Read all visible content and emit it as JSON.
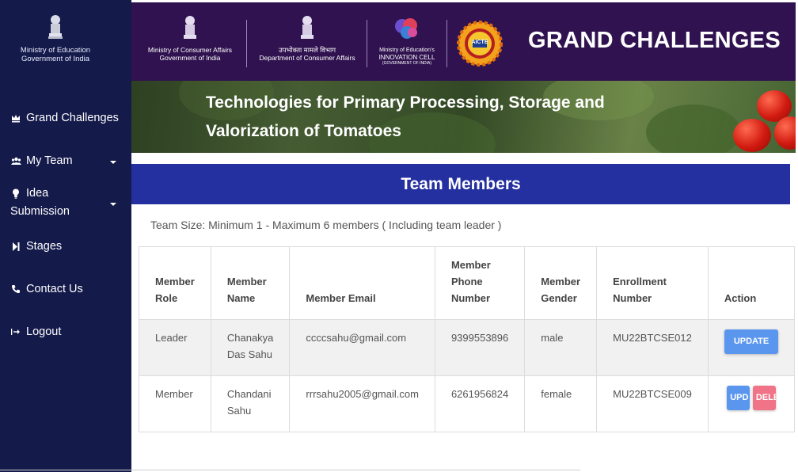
{
  "sidebar": {
    "logo_lines": [
      "Ministry of Education",
      "Government of India"
    ],
    "items": [
      {
        "label": "Grand Challenges",
        "icon": "crown-icon"
      },
      {
        "label": "My Team",
        "icon": "users-icon"
      },
      {
        "label": "Idea",
        "label2": "Submission",
        "icon": "bulb-icon"
      },
      {
        "label": "Stages",
        "icon": "step-forward-icon"
      },
      {
        "label": "Contact Us",
        "icon": "phone-icon"
      },
      {
        "label": "Logout",
        "icon": "logout-icon"
      }
    ]
  },
  "header": {
    "logo1": [
      "Ministry of Consumer Affairs",
      "Government of India"
    ],
    "logo2": [
      "उपभोक्ता मामले विभाग",
      "Department of Consumer Affairs"
    ],
    "logo3": [
      "Ministry of Education's",
      "INNOVATION CELL",
      "(GOVERNMENT OF INDIA)"
    ],
    "logo4_text": "AICTE",
    "title": "GRAND CHALLENGES"
  },
  "banner": {
    "line1": "Technologies for Primary Processing, Storage and",
    "line2": "Valorization of Tomatoes"
  },
  "team": {
    "heading": "Team Members",
    "size_note": "Team Size: Minimum 1 - Maximum 6 members ( Including team leader )",
    "columns": {
      "role": [
        "Member",
        "Role"
      ],
      "name": [
        "Member",
        "Name"
      ],
      "email": [
        "Member Email"
      ],
      "phone": [
        "Member",
        "Phone",
        "Number"
      ],
      "gender": [
        "Member",
        "Gender"
      ],
      "enroll": [
        "Enrollment",
        "Number"
      ],
      "action": [
        "Action"
      ]
    },
    "rows": [
      {
        "role": "Leader",
        "name1": "Chanakya",
        "name2": "Das Sahu",
        "email": "ccccsahu@gmail.com",
        "phone": "9399553896",
        "gender": "male",
        "enroll": "MU22BTCSE012",
        "update": "UPDATE"
      },
      {
        "role": "Member",
        "name1": "Chandani",
        "name2": "Sahu",
        "email": "rrrsahu2005@gmail.com",
        "phone": "6261956824",
        "gender": "female",
        "enroll": "MU22BTCSE009",
        "update": "UPD",
        "delete": "DELE"
      }
    ]
  },
  "colors": {
    "sidebar_bg": "#141a4a",
    "header_bg": "#2f124f",
    "team_bar": "#2430a0",
    "update_btn": "#5b96ee",
    "delete_btn": "#f07387"
  }
}
